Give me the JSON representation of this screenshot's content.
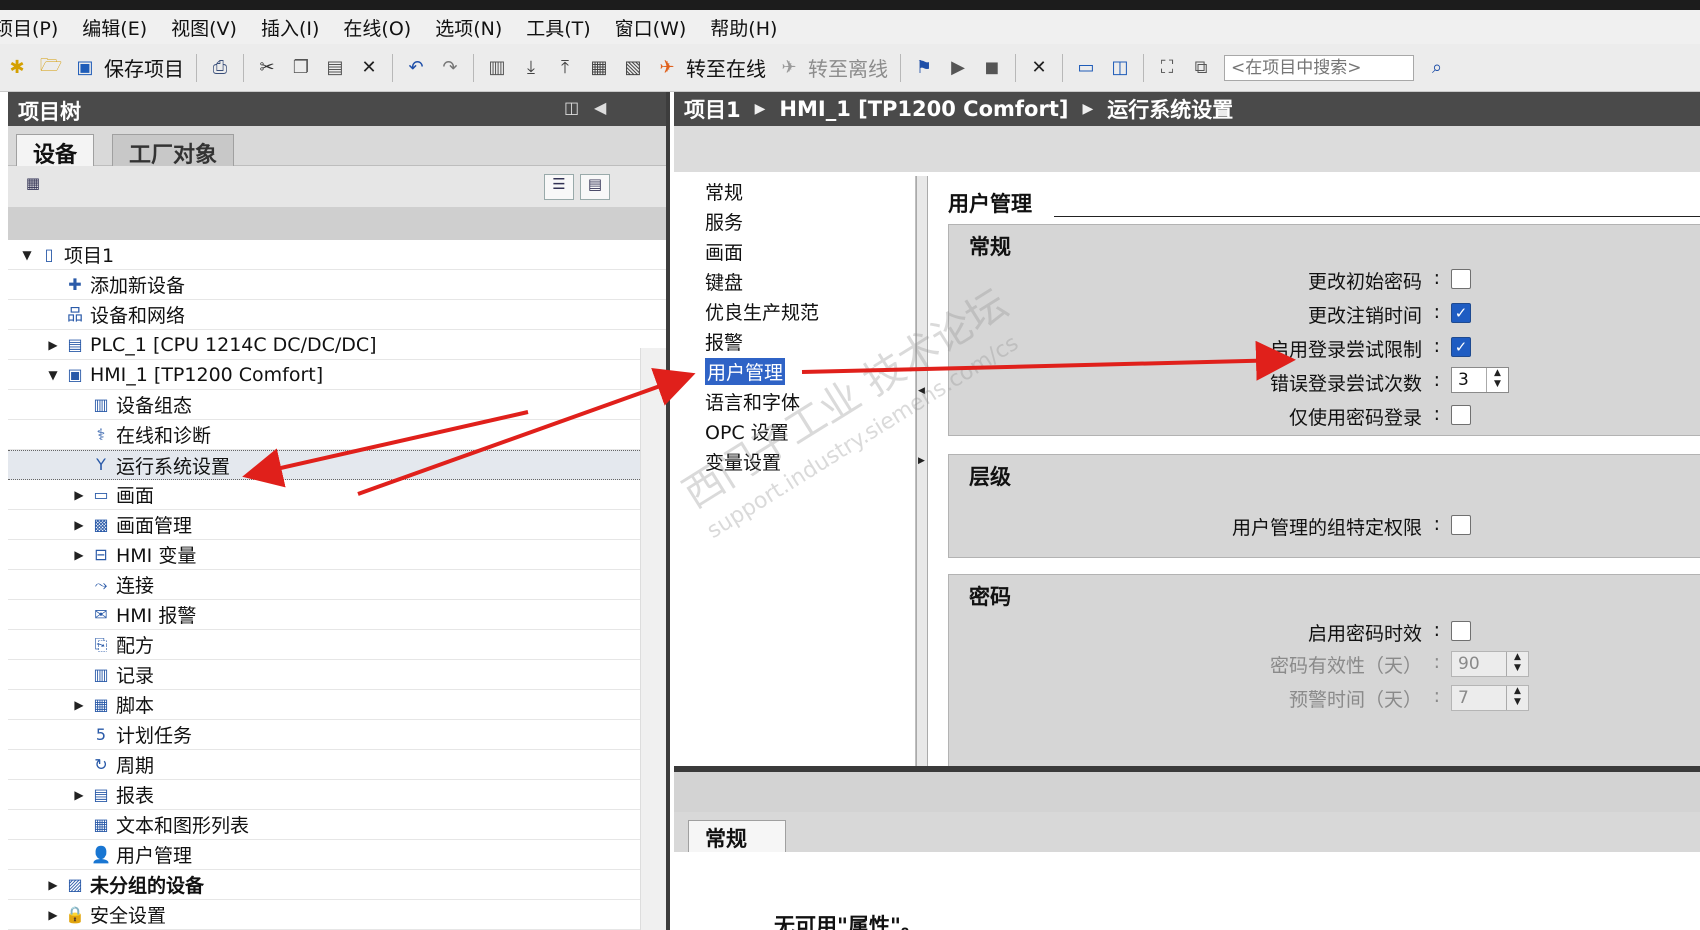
{
  "titlebar": {
    "text": ""
  },
  "menu": [
    "项目(P)",
    "编辑(E)",
    "视图(V)",
    "插入(I)",
    "在线(O)",
    "选项(N)",
    "工具(T)",
    "窗口(W)",
    "帮助(H)"
  ],
  "toolbar": {
    "save_label": "保存项目",
    "go_online_label": "转至在线",
    "go_offline_label": "转至离线",
    "search_placeholder": "<在项目中搜索>"
  },
  "project_tree": {
    "title": "项目树",
    "tabs": [
      "设备",
      "工厂对象"
    ],
    "items": [
      {
        "label": "项目1",
        "level": 0,
        "expand": "open",
        "icon": "project-icon",
        "bold": false
      },
      {
        "label": "添加新设备",
        "level": 1,
        "expand": "",
        "icon": "add-device-icon",
        "bold": false
      },
      {
        "label": "设备和网络",
        "level": 1,
        "expand": "",
        "icon": "network-icon",
        "bold": false
      },
      {
        "label": "PLC_1 [CPU 1214C DC/DC/DC]",
        "level": 1,
        "expand": "closed",
        "icon": "plc-icon",
        "bold": false
      },
      {
        "label": "HMI_1 [TP1200 Comfort]",
        "level": 1,
        "expand": "open",
        "icon": "hmi-icon",
        "bold": false
      },
      {
        "label": "设备组态",
        "level": 2,
        "expand": "",
        "icon": "device-config-icon",
        "bold": false
      },
      {
        "label": "在线和诊断",
        "level": 2,
        "expand": "",
        "icon": "diagnostics-icon",
        "bold": false
      },
      {
        "label": "运行系统设置",
        "level": 2,
        "expand": "",
        "icon": "runtime-settings-icon",
        "bold": false,
        "selected": true
      },
      {
        "label": "画面",
        "level": 2,
        "expand": "closed",
        "icon": "screens-folder-icon",
        "bold": false
      },
      {
        "label": "画面管理",
        "level": 2,
        "expand": "closed",
        "icon": "screen-management-icon",
        "bold": false
      },
      {
        "label": "HMI 变量",
        "level": 2,
        "expand": "closed",
        "icon": "hmi-tags-icon",
        "bold": false
      },
      {
        "label": "连接",
        "level": 2,
        "expand": "",
        "icon": "connections-icon",
        "bold": false
      },
      {
        "label": "HMI 报警",
        "level": 2,
        "expand": "",
        "icon": "hmi-alarms-icon",
        "bold": false
      },
      {
        "label": "配方",
        "level": 2,
        "expand": "",
        "icon": "recipes-icon",
        "bold": false
      },
      {
        "label": "记录",
        "level": 2,
        "expand": "",
        "icon": "logs-icon",
        "bold": false
      },
      {
        "label": "脚本",
        "level": 2,
        "expand": "closed",
        "icon": "scripts-icon",
        "bold": false
      },
      {
        "label": "计划任务",
        "level": 2,
        "expand": "",
        "icon": "scheduled-tasks-icon",
        "bold": false
      },
      {
        "label": "周期",
        "level": 2,
        "expand": "",
        "icon": "cycles-icon",
        "bold": false
      },
      {
        "label": "报表",
        "level": 2,
        "expand": "closed",
        "icon": "reports-icon",
        "bold": false
      },
      {
        "label": "文本和图形列表",
        "level": 2,
        "expand": "",
        "icon": "text-graphic-lists-icon",
        "bold": false
      },
      {
        "label": "用户管理",
        "level": 2,
        "expand": "",
        "icon": "user-admin-icon",
        "bold": false
      },
      {
        "label": "未分组的设备",
        "level": 1,
        "expand": "closed",
        "icon": "ungrouped-devices-icon",
        "bold": true
      },
      {
        "label": "安全设置",
        "level": 1,
        "expand": "closed",
        "icon": "security-icon",
        "bold": false
      }
    ]
  },
  "breadcrumb": [
    "项目1",
    "HMI_1 [TP1200 Comfort]",
    "运行系统设置"
  ],
  "nav": {
    "items": [
      "常规",
      "服务",
      "画面",
      "键盘",
      "优良生产规范",
      "报警",
      "用户管理",
      "语言和字体",
      "OPC 设置",
      "变量设置"
    ],
    "selected_index": 6
  },
  "content": {
    "title": "用户管理",
    "groups": {
      "general": {
        "title": "常规",
        "change_initial_password": {
          "label": "更改初始密码",
          "checked": false
        },
        "change_logoff_time": {
          "label": "更改注销时间",
          "checked": true
        },
        "enable_login_attempt_limit": {
          "label": "启用登录尝试限制",
          "checked": true
        },
        "failed_login_attempts": {
          "label": "错误登录尝试次数",
          "value": "3"
        },
        "password_only_login": {
          "label": "仅使用密码登录",
          "checked": false
        }
      },
      "hierarchy": {
        "title": "层级",
        "group_specific_rights": {
          "label": "用户管理的组特定权限",
          "checked": false
        }
      },
      "password": {
        "title": "密码",
        "enable_password_aging": {
          "label": "启用密码时效",
          "checked": false
        },
        "password_validity_days": {
          "label": "密码有效性（天）",
          "value": "90"
        },
        "warning_time_days": {
          "label": "预警时间（天）",
          "value": "7"
        }
      }
    }
  },
  "inspector": {
    "tab": "常规",
    "message": "无可用\"属性\"。"
  },
  "watermark": {
    "main": "西门子工业 技术论坛",
    "url": "support.industry.siemens.com/cs"
  },
  "colors": {
    "selection_blue": "#2f63c6",
    "checkbox_blue": "#1e5cc2",
    "annotation_red": "#e0201b",
    "header_gray": "#4a4a4a"
  }
}
